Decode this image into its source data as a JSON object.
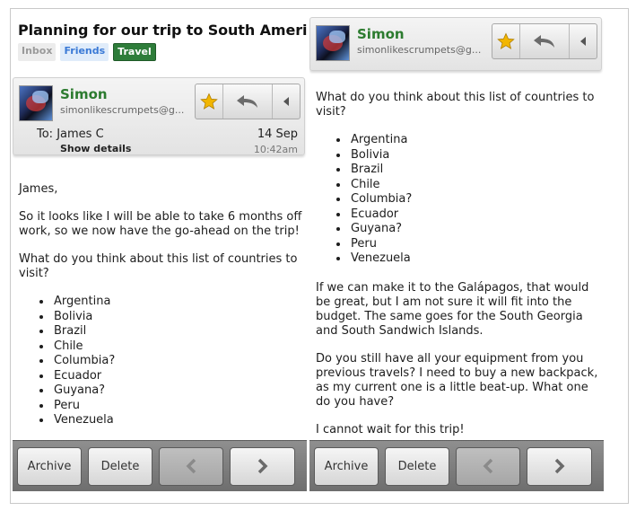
{
  "left_pane": {
    "subject": "Planning for our trip to South America",
    "labels": {
      "inbox": "Inbox",
      "friends": "Friends",
      "travel": "Travel"
    },
    "sender": {
      "name": "Simon",
      "email": "simonlikescrumpets@g..."
    },
    "to_line": "To: James C",
    "date": "14 Sep",
    "show_details": "Show details",
    "time": "10:42am",
    "body": {
      "greeting": "James,",
      "para1": "So it looks like I will be able to take 6 months off work, so we now have the go-ahead on the trip!",
      "question": "What do you think about this list of countries to visit?",
      "countries": [
        "Argentina",
        "Bolivia",
        "Brazil",
        "Chile",
        "Columbia?",
        "Ecuador",
        "Guyana?",
        "Peru",
        "Venezuela"
      ]
    }
  },
  "right_pane": {
    "sender": {
      "name": "Simon",
      "email": "simonlikescrumpets@g..."
    },
    "body": {
      "question": "What do you think about this list of countries to visit?",
      "countries": [
        "Argentina",
        "Bolivia",
        "Brazil",
        "Chile",
        "Columbia?",
        "Ecuador",
        "Guyana?",
        "Peru",
        "Venezuela"
      ],
      "para_galapagos": "If we can make it to the Galápagos, that would be great, but I am not sure it will fit into the budget. The same goes for the South Georgia and South Sandwich Islands.",
      "para_equipment": "Do you still have all your equipment from you previous travels? I need to buy a new backpack, as my current one is a little beat-up. What one do you have?",
      "closing": "I cannot wait for this trip!"
    }
  },
  "bottom_bar": {
    "archive": "Archive",
    "delete": "Delete"
  },
  "colors": {
    "sender_green": "#2c7b2f",
    "star_gold": "#f2b600",
    "travel_label": "#2e7d3a",
    "friends_label": "#3b7ad6"
  },
  "icons": {
    "star": "star-icon",
    "reply": "reply-arrow-icon",
    "more": "caret-left-icon",
    "prev": "chevron-left-icon",
    "next": "chevron-right-icon"
  }
}
